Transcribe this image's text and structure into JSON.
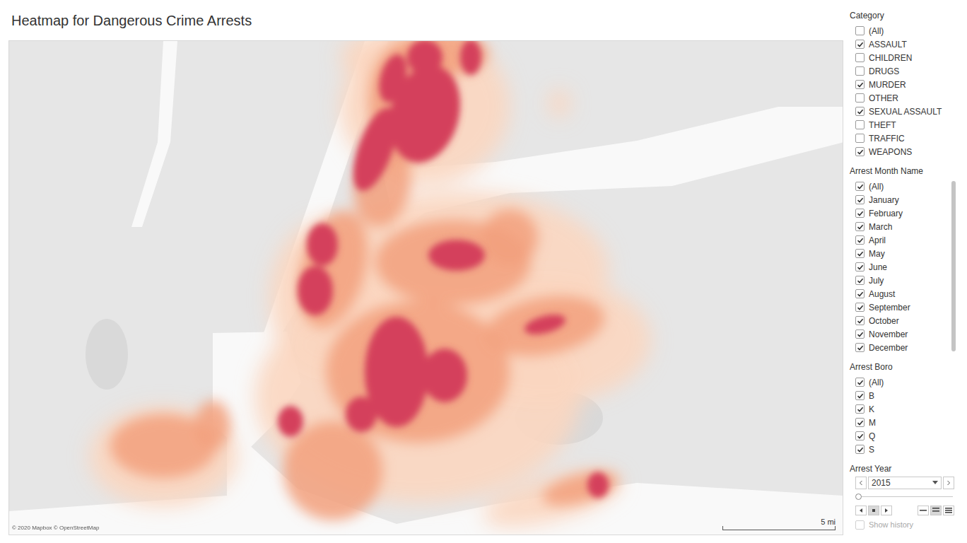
{
  "title": "Heatmap for Dangerous Crime Arrests",
  "map": {
    "attribution": "© 2020 Mapbox © OpenStreetMap",
    "scale": "5 mi"
  },
  "filters": [
    {
      "title": "Category",
      "scrollable": false,
      "items": [
        {
          "label": "(All)",
          "checked": false
        },
        {
          "label": "ASSAULT",
          "checked": true
        },
        {
          "label": "CHILDREN",
          "checked": false
        },
        {
          "label": "DRUGS",
          "checked": false
        },
        {
          "label": "MURDER",
          "checked": true
        },
        {
          "label": "OTHER",
          "checked": false
        },
        {
          "label": "SEXUAL ASSAULT",
          "checked": true
        },
        {
          "label": "THEFT",
          "checked": false
        },
        {
          "label": "TRAFFIC",
          "checked": false
        },
        {
          "label": "WEAPONS",
          "checked": true
        }
      ]
    },
    {
      "title": "Arrest Month Name",
      "scrollable": true,
      "items": [
        {
          "label": "(All)",
          "checked": true
        },
        {
          "label": "January",
          "checked": true
        },
        {
          "label": "February",
          "checked": true
        },
        {
          "label": "March",
          "checked": true
        },
        {
          "label": "April",
          "checked": true
        },
        {
          "label": "May",
          "checked": true
        },
        {
          "label": "June",
          "checked": true
        },
        {
          "label": "July",
          "checked": true
        },
        {
          "label": "August",
          "checked": true
        },
        {
          "label": "September",
          "checked": true
        },
        {
          "label": "October",
          "checked": true
        },
        {
          "label": "November",
          "checked": true
        },
        {
          "label": "December",
          "checked": true
        }
      ]
    },
    {
      "title": "Arrest Boro",
      "scrollable": false,
      "items": [
        {
          "label": "(All)",
          "checked": true
        },
        {
          "label": "B",
          "checked": true
        },
        {
          "label": "K",
          "checked": true
        },
        {
          "label": "M",
          "checked": true
        },
        {
          "label": "Q",
          "checked": true
        },
        {
          "label": "S",
          "checked": true
        }
      ]
    }
  ],
  "year": {
    "title": "Arrest Year",
    "value": "2015",
    "level": 0,
    "show_history": {
      "label": "Show history",
      "checked": false,
      "disabled": true
    }
  }
}
